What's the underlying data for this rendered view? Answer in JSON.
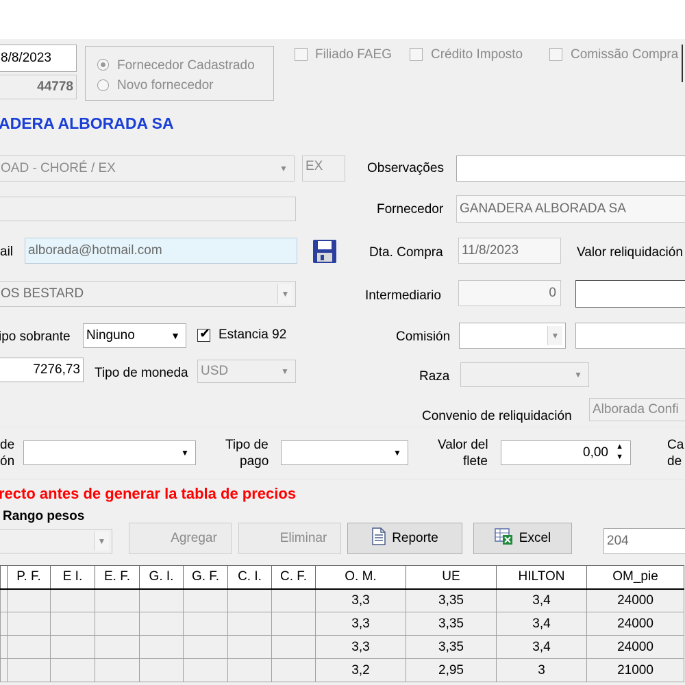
{
  "header": {
    "date": "8/8/2023",
    "number": "44778",
    "supplier_name": "ADERA ALBORADA SA"
  },
  "supplier_type": {
    "option_registered": "Fornecedor Cadastrado",
    "option_new": "Novo fornecedor",
    "selected": "registered"
  },
  "flags": {
    "filiado": "Filiado FAEG",
    "credito": "Crédito Imposto",
    "comissao": "Comissão Compra"
  },
  "left": {
    "location_value": "OAD - CHORÉ / EX",
    "location_code": "EX",
    "blank_field": "",
    "email_label": "ail",
    "email_value": "alborada@hotmail.com",
    "contact_value": "OS BESTARD",
    "tipo_sobrante_label": "ipo sobrante",
    "tipo_sobrante_value": "Ninguno",
    "estancia_label": "Estancia 92",
    "amount_value": "7276,73",
    "tipo_moneda_label": "Tipo de moneda",
    "tipo_moneda_value": "USD"
  },
  "right": {
    "observacoes_label": "Observações",
    "observacoes_value": "",
    "fornecedor_label": "Fornecedor",
    "fornecedor_value": "GANADERA ALBORADA SA",
    "dta_compra_label": "Dta. Compra",
    "dta_compra_value": "11/8/2023",
    "valor_reliq_label": "Valor reliquidación",
    "intermediario_label": "Intermediario",
    "intermediario_value": "0",
    "comision_label": "Comisión",
    "raza_label": "Raza",
    "convenio_label": "Convenio de reliquidación",
    "convenio_value": "Alborada Confi"
  },
  "payment_row": {
    "left_label_1": "de",
    "left_label_2": "ón",
    "tipo_pago_label_1": "Tipo de",
    "tipo_pago_label_2": "pago",
    "valor_flete_label_1": "Valor del",
    "valor_flete_label_2": "flete",
    "valor_flete_value": "0,00",
    "right_label_1": "Ca",
    "right_label_2": "de"
  },
  "warning": "recto antes de generar la tabla de precios",
  "rango_label": "Rango pesos",
  "toolbar": {
    "agregar": "Agregar",
    "eliminar": "Eliminar",
    "reporte": "Reporte",
    "excel": "Excel",
    "code_value": "204"
  },
  "colors": {
    "warning": "#ff0000",
    "supplier_name": "#1a3fd6",
    "email_bg": "#e6f5fb"
  },
  "grid": {
    "columns": [
      "",
      "P. F.",
      "E I.",
      "E. F.",
      "G. I.",
      "G. F.",
      "C. I.",
      "C. F.",
      "O. M.",
      "UE",
      "HILTON",
      "OM_pie"
    ],
    "rows": [
      [
        "",
        "",
        "",
        "",
        "",
        "",
        "",
        "",
        "3,3",
        "3,35",
        "3,4",
        "24000"
      ],
      [
        "",
        "",
        "",
        "",
        "",
        "",
        "",
        "",
        "3,3",
        "3,35",
        "3,4",
        "24000"
      ],
      [
        "",
        "",
        "",
        "",
        "",
        "",
        "",
        "",
        "3,3",
        "3,35",
        "3,4",
        "24000"
      ],
      [
        "",
        "",
        "",
        "",
        "",
        "",
        "",
        "",
        "3,2",
        "2,95",
        "3",
        "21000"
      ]
    ]
  }
}
